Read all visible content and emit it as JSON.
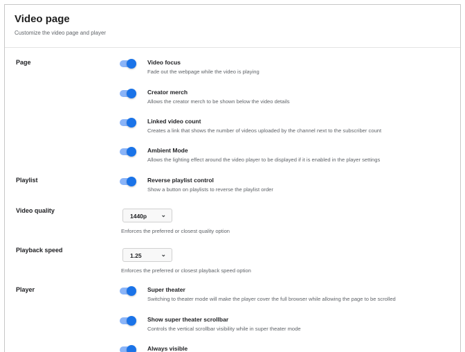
{
  "header": {
    "title": "Video page",
    "subtitle": "Customize the video page and player"
  },
  "sections": {
    "page": {
      "label": "Page",
      "video_focus": {
        "title": "Video focus",
        "desc": "Fade out the webpage while the video is playing",
        "enabled": true
      },
      "creator_merch": {
        "title": "Creator merch",
        "desc": "Allows the creator merch to be shown below the video details",
        "enabled": true
      },
      "linked_video_count": {
        "title": "Linked video count",
        "desc": "Creates a link that shows the number of videos uploaded by the channel next to the subscriber count",
        "enabled": true
      },
      "ambient_mode": {
        "title": "Ambient Mode",
        "desc": "Allows the lighting effect around the video player to be displayed if it is enabled in the player settings",
        "enabled": true
      }
    },
    "playlist": {
      "label": "Playlist",
      "reverse_control": {
        "title": "Reverse playlist control",
        "desc": "Show a button on playlists to reverse the playlist order",
        "enabled": true
      }
    },
    "video_quality": {
      "label": "Video quality",
      "value": "1440p",
      "desc": "Enforces the preferred or closest quality option"
    },
    "playback_speed": {
      "label": "Playback speed",
      "value": "1.25",
      "desc": "Enforces the preferred or closest playback speed option"
    },
    "player": {
      "label": "Player",
      "super_theater": {
        "title": "Super theater",
        "desc": "Switching to theater mode will make the player cover the full browser while allowing the page to be scrolled",
        "enabled": true
      },
      "super_theater_scrollbar": {
        "title": "Show super theater scrollbar",
        "desc": "Controls the vertical scrollbar visibility while in super theater mode",
        "enabled": true
      },
      "always_visible": {
        "title": "Always visible",
        "desc": "",
        "enabled": true
      }
    }
  },
  "icons": {
    "dropdown": "chevron-down-icon"
  },
  "colors": {
    "toggle_track": "#8ab4f8",
    "toggle_knob": "#1a73e8"
  }
}
